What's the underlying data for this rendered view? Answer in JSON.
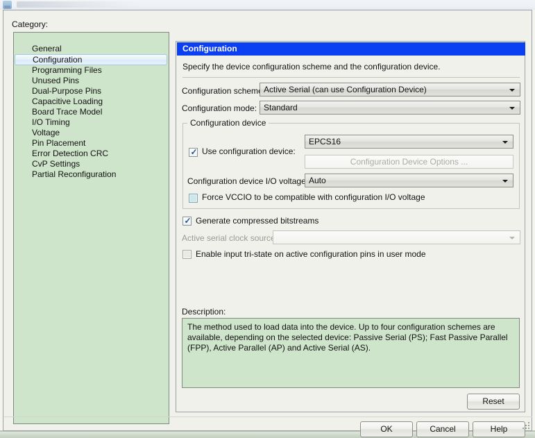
{
  "dialog": {
    "category_label": "Category:",
    "categories": [
      "General",
      "Configuration",
      "Programming Files",
      "Unused Pins",
      "Dual-Purpose Pins",
      "Capacitive Loading",
      "Board Trace Model",
      "I/O Timing",
      "Voltage",
      "Pin Placement",
      "Error Detection CRC",
      "CvP Settings",
      "Partial Reconfiguration"
    ],
    "selected_category": "Configuration"
  },
  "panel": {
    "title": "Configuration",
    "subtitle": "Specify the device configuration scheme and the configuration device.",
    "scheme_label": "Configuration scheme:",
    "scheme_value": "Active Serial (can use Configuration Device)",
    "mode_label": "Configuration mode:",
    "mode_value": "Standard",
    "group_title": "Configuration device",
    "device_value": "EPCS16",
    "use_device_label": "Use configuration device:",
    "device_options_button": "Configuration Device Options ...",
    "io_voltage_label": "Configuration device I/O voltage:",
    "io_voltage_value": "Auto",
    "force_vccio_label": "Force VCCIO to be compatible with configuration I/O voltage",
    "compressed_label": "Generate compressed bitstreams",
    "clock_source_label": "Active serial clock source:",
    "clock_source_value": "",
    "tristate_label": "Enable input tri-state on active configuration pins in user mode"
  },
  "description": {
    "label": "Description:",
    "text": "The method used to load data into the device. Up to four configuration schemes are available, depending on the selected device: Passive Serial (PS); Fast Passive Parallel (FPP), Active Parallel (AP) and Active Serial (AS)."
  },
  "buttons": {
    "reset": "Reset",
    "ok": "OK",
    "cancel": "Cancel",
    "help": "Help"
  },
  "checkbox_state": {
    "use_configuration_device": "checked",
    "force_vccio": "unchecked",
    "generate_compressed_bitstreams": "checked",
    "enable_tristate": "unchecked"
  },
  "colors": {
    "panel_title_bg": "#0a3ff2",
    "list_green": "#cfe5cb",
    "dialog_bg": "#f1f1ec"
  }
}
